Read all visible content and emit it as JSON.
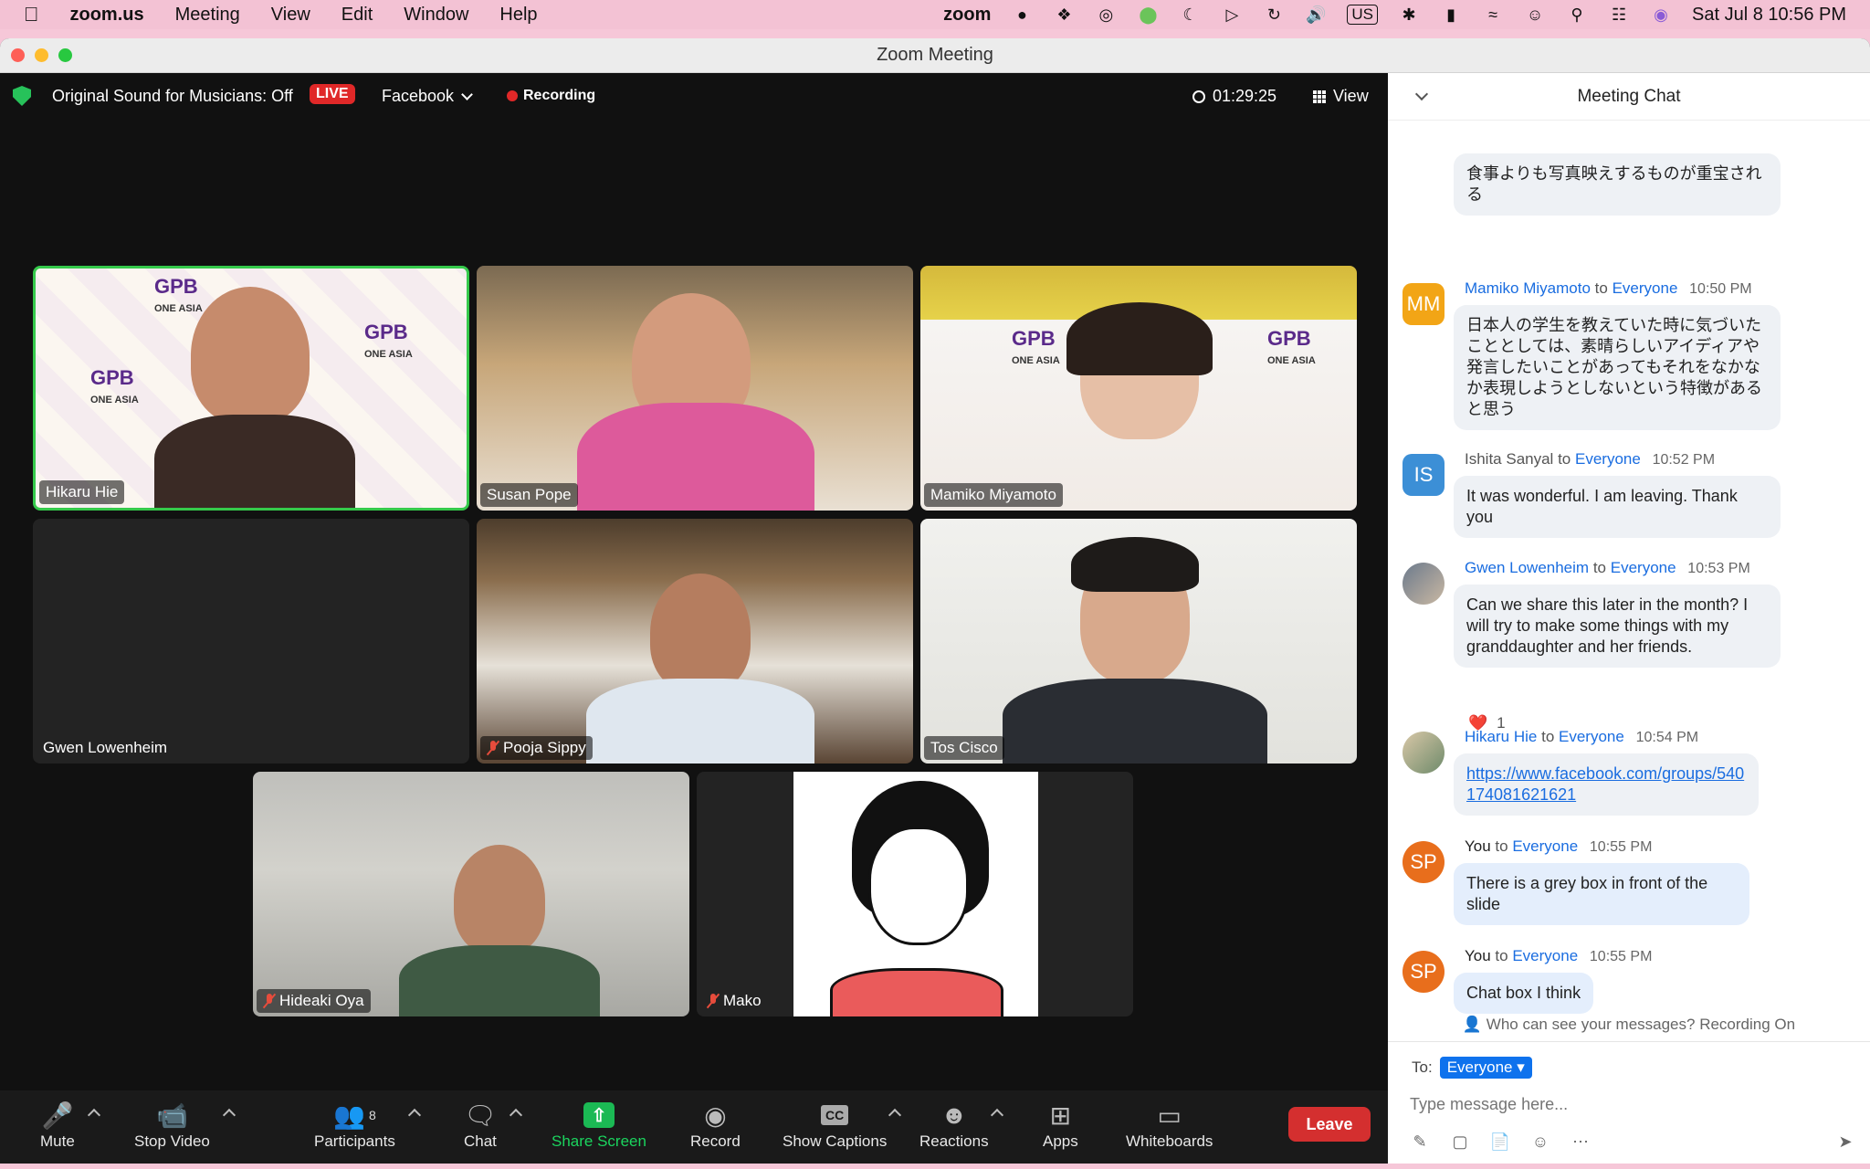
{
  "menubar": {
    "app": "zoom.us",
    "items": [
      "Meeting",
      "View",
      "Edit",
      "Window",
      "Help"
    ],
    "status_zoom": "zoom",
    "input_source": "US",
    "clock": "Sat Jul 8  10:56 PM"
  },
  "window": {
    "title": "Zoom Meeting"
  },
  "topbar": {
    "sound": "Original Sound for Musicians: Off",
    "live": "LIVE",
    "stream": "Facebook",
    "recording": "Recording",
    "timer": "01:29:25",
    "view": "View"
  },
  "participants": [
    {
      "name": "Hikaru Hie",
      "muted": false,
      "active": true
    },
    {
      "name": "Susan Pope",
      "muted": false,
      "active": false
    },
    {
      "name": "Mamiko Miyamoto",
      "muted": false,
      "active": false
    },
    {
      "name": "Gwen Lowenheim",
      "muted": false,
      "active": false
    },
    {
      "name": "Pooja Sippy",
      "muted": true,
      "active": false
    },
    {
      "name": "Tos Cisco",
      "muted": false,
      "active": false
    },
    {
      "name": "Hideaki Oya",
      "muted": true,
      "active": false
    },
    {
      "name": "Mako",
      "muted": true,
      "active": false
    }
  ],
  "logo_text": {
    "gpb": "GPB",
    "one_asia": "ONE ASIA"
  },
  "controls": {
    "mute": "Mute",
    "stop_video": "Stop Video",
    "participants": "Participants",
    "participants_count": "8",
    "chat": "Chat",
    "share_screen": "Share Screen",
    "record": "Record",
    "captions": "Show Captions",
    "cc": "CC",
    "reactions": "Reactions",
    "apps": "Apps",
    "whiteboards": "Whiteboards",
    "leave": "Leave"
  },
  "chat": {
    "title": "Meeting Chat",
    "messages": [
      {
        "sender": "",
        "to": "",
        "time": "",
        "initials": "",
        "text": "食事よりも写真映えするものが重宝される"
      },
      {
        "sender": "Mamiko Miyamoto",
        "to_word": "to",
        "to": "Everyone",
        "time": "10:50 PM",
        "initials": "MM",
        "color": "#f2a516",
        "text": "日本人の学生を教えていた時に気づいたこととしては、素晴らしいアイディアや発言したいことがあってもそれをなかなか表現しようとしないという特徴があると思う"
      },
      {
        "sender": "Ishita Sanyal",
        "to_word": "to",
        "to": "Everyone",
        "time": "10:52 PM",
        "initials": "IS",
        "color": "#3c8fd6",
        "text": "It was wonderful. I am leaving. Thank you"
      },
      {
        "sender": "Gwen Lowenheim",
        "to_word": "to",
        "to": "Everyone",
        "time": "10:53 PM",
        "initials": "",
        "text": "Can we share this later in the month? I will try to make some things with my granddaughter and her friends.",
        "reaction": "❤️",
        "reaction_count": "1"
      },
      {
        "sender": "Hikaru Hie",
        "to_word": "to",
        "to": "Everyone",
        "time": "10:54 PM",
        "initials": "",
        "text": "https://www.facebook.com/groups/540174081621621"
      },
      {
        "sender": "You",
        "to_word": "to",
        "to": "Everyone",
        "time": "10:55 PM",
        "initials": "SP",
        "color": "#e86e1c",
        "text": "There is a grey box in front of the slide"
      },
      {
        "sender": "You",
        "to_word": "to",
        "to": "Everyone",
        "time": "10:55 PM",
        "initials": "SP",
        "color": "#e86e1c",
        "text": "Chat box I think"
      }
    ],
    "who_can_see": "Who can see your messages? Recording On",
    "to_label": "To:",
    "to_value": "Everyone",
    "placeholder": "Type message here..."
  }
}
